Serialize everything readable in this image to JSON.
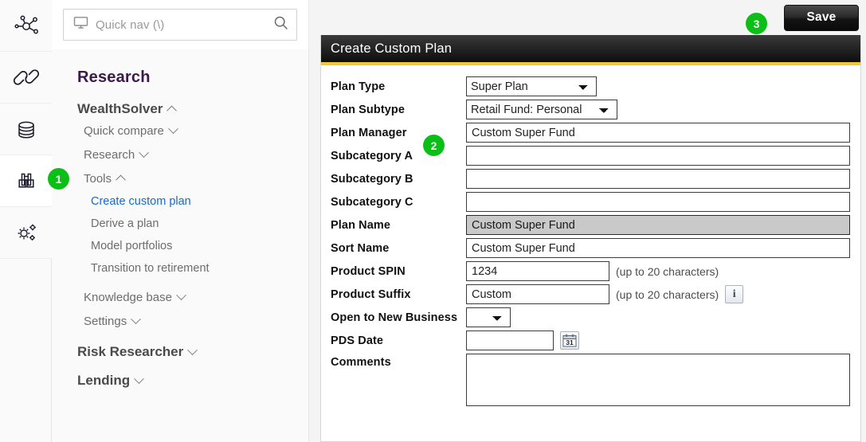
{
  "colors": {
    "accent_rule": "#f2ca30",
    "badge_green": "#0bbf16",
    "link_blue": "#1669d6",
    "header_black": "#0d0d0d",
    "brand_purple": "#3a1a4a"
  },
  "rail": {
    "items": [
      {
        "icon": "network-nodes-icon",
        "active": false
      },
      {
        "icon": "link-chain-icon",
        "active": false
      },
      {
        "icon": "coins-stack-icon",
        "active": false
      },
      {
        "icon": "binoculars-icon",
        "active": true
      },
      {
        "icon": "gears-settings-icon",
        "active": false
      }
    ]
  },
  "search": {
    "placeholder": "Quick nav (\\)",
    "monitor_icon": "monitor-icon",
    "search_icon": "search-icon"
  },
  "sidebar": {
    "title": "Research",
    "groups": [
      {
        "label": "WealthSolver",
        "expanded": true,
        "items": [
          {
            "label": "Quick compare",
            "expandable": true,
            "expanded": false,
            "selected": false
          },
          {
            "label": "Research",
            "expandable": true,
            "expanded": false,
            "selected": false
          },
          {
            "label": "Tools",
            "expandable": true,
            "expanded": true,
            "selected": false
          }
        ],
        "tools_children": [
          {
            "label": "Create custom plan",
            "selected": true
          },
          {
            "label": "Derive a plan",
            "selected": false
          },
          {
            "label": "Model portfolios",
            "selected": false
          },
          {
            "label": "Transition to retirement",
            "selected": false
          }
        ],
        "trailing": [
          {
            "label": "Knowledge base",
            "expandable": true,
            "expanded": false
          },
          {
            "label": "Settings",
            "expandable": true,
            "expanded": false
          }
        ]
      },
      {
        "label": "Risk Researcher",
        "expanded": false
      },
      {
        "label": "Lending",
        "expanded": false
      }
    ]
  },
  "toolbar": {
    "save_label": "Save"
  },
  "panel": {
    "title": "Create Custom Plan"
  },
  "form": {
    "plan_type": {
      "label": "Plan Type",
      "value": "Super Plan",
      "options": [
        "Super Plan"
      ]
    },
    "plan_subtype": {
      "label": "Plan Subtype",
      "value": "Retail Fund: Personal",
      "options": [
        "Retail Fund: Personal"
      ]
    },
    "plan_manager": {
      "label": "Plan Manager",
      "value": "Custom Super Fund"
    },
    "subcategory_a": {
      "label": "Subcategory A",
      "value": ""
    },
    "subcategory_b": {
      "label": "Subcategory B",
      "value": ""
    },
    "subcategory_c": {
      "label": "Subcategory C",
      "value": ""
    },
    "plan_name": {
      "label": "Plan Name",
      "value": "Custom Super Fund",
      "readonly": true
    },
    "sort_name": {
      "label": "Sort Name",
      "value": "Custom Super Fund"
    },
    "product_spin": {
      "label": "Product SPIN",
      "value": "1234",
      "hint": "(up to 20 characters)"
    },
    "product_suffix": {
      "label": "Product Suffix",
      "value": "Custom",
      "hint": "(up to 20 characters)",
      "info_icon": "info-icon"
    },
    "open_new_business": {
      "label": "Open to New Business",
      "value": "",
      "options": [
        ""
      ]
    },
    "pds_date": {
      "label": "PDS Date",
      "value": "",
      "calendar_icon": "calendar-icon",
      "calendar_day": "31"
    },
    "comments": {
      "label": "Comments",
      "value": ""
    }
  },
  "badges": [
    {
      "number": "1"
    },
    {
      "number": "2"
    },
    {
      "number": "3"
    }
  ]
}
